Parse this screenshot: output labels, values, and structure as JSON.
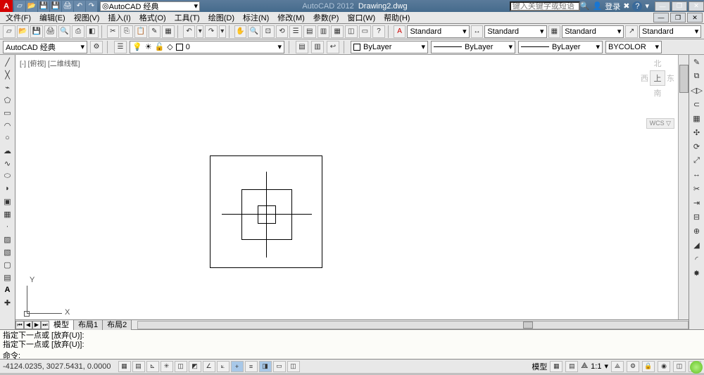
{
  "title": {
    "app": "AutoCAD 2012",
    "file": "Drawing2.dwg"
  },
  "workspace_selector": "AutoCAD 经典",
  "search_placeholder": "键入关键字或短语",
  "login": "登录",
  "menu": [
    "文件(F)",
    "编辑(E)",
    "视图(V)",
    "插入(I)",
    "格式(O)",
    "工具(T)",
    "绘图(D)",
    "标注(N)",
    "修改(M)",
    "参数(P)",
    "窗口(W)",
    "帮助(H)"
  ],
  "workspace_label": "AutoCAD 经典",
  "std_dropdowns": {
    "style1": "Standard",
    "style2": "Standard",
    "style3": "Standard",
    "style4": "Standard"
  },
  "layer": {
    "current": "0"
  },
  "props": {
    "bylayer1": "ByLayer",
    "bylayer2": "ByLayer",
    "bylayer3": "ByLayer",
    "bycolor": "BYCOLOR"
  },
  "view_label": "[-] [俯视] [二维线框]",
  "viewcube": {
    "n": "北",
    "s": "南",
    "e": "东",
    "w": "西",
    "top": "上"
  },
  "wcs": "WCS ▽",
  "ucs": {
    "x": "X",
    "y": "Y"
  },
  "tabs": {
    "model": "模型",
    "layout1": "布局1",
    "layout2": "布局2"
  },
  "cmd": {
    "line1": "指定下一点或 [放弃(U)]:",
    "line2": "指定下一点或 [放弃(U)]:",
    "prompt": "命令:"
  },
  "status": {
    "coords": "-4124.0235, 3027.5431, 0.0000",
    "space": "模型",
    "scale": "1:1"
  },
  "icons": {
    "new": "▱",
    "open": "📂",
    "save": "💾",
    "print": "🖨",
    "undo": "↶",
    "redo": "↷",
    "search": "🔍",
    "help": "?",
    "close": "✕",
    "min": "—",
    "max": "❐"
  }
}
